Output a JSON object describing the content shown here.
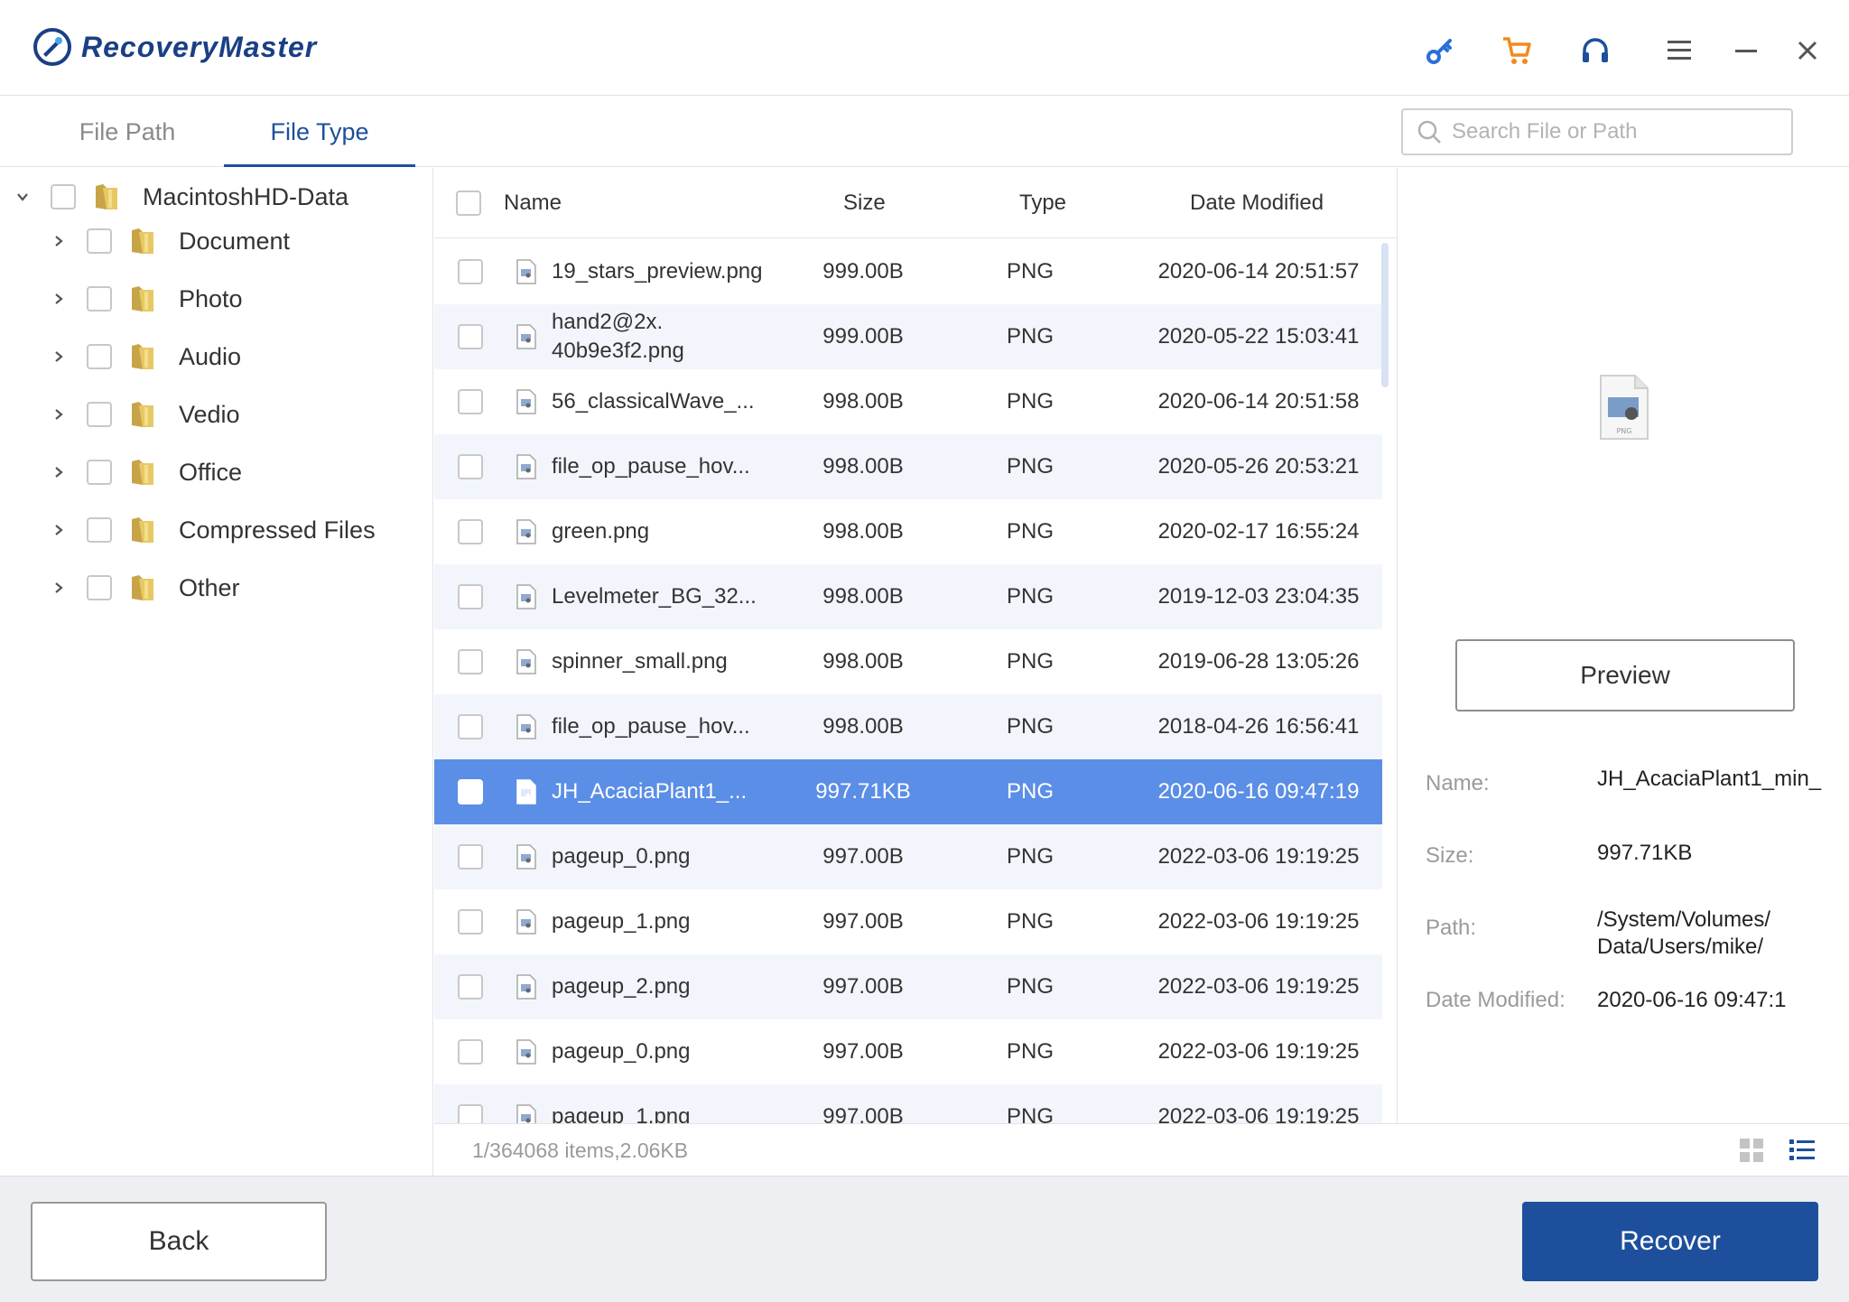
{
  "app": {
    "title": "RecoveryMaster",
    "brand_color": "#1d4f9c",
    "accent_color": "#5b8ee6",
    "cart_color": "#f28a1f",
    "toolbar_icons": [
      "key-icon",
      "cart-icon",
      "headset-icon",
      "menu-icon",
      "minimize-icon",
      "close-icon"
    ]
  },
  "tabs": [
    {
      "label": "File Path",
      "active": false
    },
    {
      "label": "File Type",
      "active": true
    }
  ],
  "search": {
    "placeholder": "Search File or Path",
    "value": ""
  },
  "tree": {
    "root": {
      "label": "MacintoshHD-Data",
      "expanded": true
    },
    "items": [
      {
        "label": "Document"
      },
      {
        "label": "Photo"
      },
      {
        "label": "Audio"
      },
      {
        "label": "Vedio"
      },
      {
        "label": "Office"
      },
      {
        "label": "Compressed Files"
      },
      {
        "label": "Other"
      }
    ]
  },
  "table": {
    "columns": [
      "Name",
      "Size",
      "Type",
      "Date Modified"
    ],
    "rows": [
      {
        "name": "19_stars_preview.png",
        "size": "999.00B",
        "type": "PNG",
        "date": "2020-06-14 20:51:57"
      },
      {
        "name": "hand2@2x.\n40b9e3f2.png",
        "size": "999.00B",
        "type": "PNG",
        "date": "2020-05-22 15:03:41"
      },
      {
        "name": "56_classicalWave_...",
        "size": "998.00B",
        "type": "PNG",
        "date": "2020-06-14 20:51:58"
      },
      {
        "name": "file_op_pause_hov...",
        "size": "998.00B",
        "type": "PNG",
        "date": "2020-05-26 20:53:21"
      },
      {
        "name": "green.png",
        "size": "998.00B",
        "type": "PNG",
        "date": "2020-02-17 16:55:24"
      },
      {
        "name": "Levelmeter_BG_32...",
        "size": "998.00B",
        "type": "PNG",
        "date": "2019-12-03 23:04:35"
      },
      {
        "name": "spinner_small.png",
        "size": "998.00B",
        "type": "PNG",
        "date": "2019-06-28 13:05:26"
      },
      {
        "name": "file_op_pause_hov...",
        "size": "998.00B",
        "type": "PNG",
        "date": "2018-04-26 16:56:41"
      },
      {
        "name": "JH_AcaciaPlant1_...",
        "size": "997.71KB",
        "type": "PNG",
        "date": "2020-06-16 09:47:19",
        "selected": true
      },
      {
        "name": "pageup_0.png",
        "size": "997.00B",
        "type": "PNG",
        "date": "2022-03-06 19:19:25"
      },
      {
        "name": "pageup_1.png",
        "size": "997.00B",
        "type": "PNG",
        "date": "2022-03-06 19:19:25"
      },
      {
        "name": "pageup_2.png",
        "size": "997.00B",
        "type": "PNG",
        "date": "2022-03-06 19:19:25"
      },
      {
        "name": "pageup_0.png",
        "size": "997.00B",
        "type": "PNG",
        "date": "2022-03-06 19:19:25"
      },
      {
        "name": "pageup_1.png",
        "size": "997.00B",
        "type": "PNG",
        "date": "2022-03-06 19:19:25"
      }
    ]
  },
  "status": {
    "text": "1/364068 items,2.06KB"
  },
  "detail": {
    "thumb_label": "PNG",
    "preview_label": "Preview",
    "name_label": "Name:",
    "name_value": "JH_AcaciaPlant1_min_",
    "size_label": "Size:",
    "size_value": "997.71KB",
    "path_label": "Path:",
    "path_value": "/System/Volumes/\nData/Users/mike/",
    "date_label": "Date Modified:",
    "date_value": "2020-06-16 09:47:1"
  },
  "footer": {
    "back_label": "Back",
    "recover_label": "Recover"
  }
}
